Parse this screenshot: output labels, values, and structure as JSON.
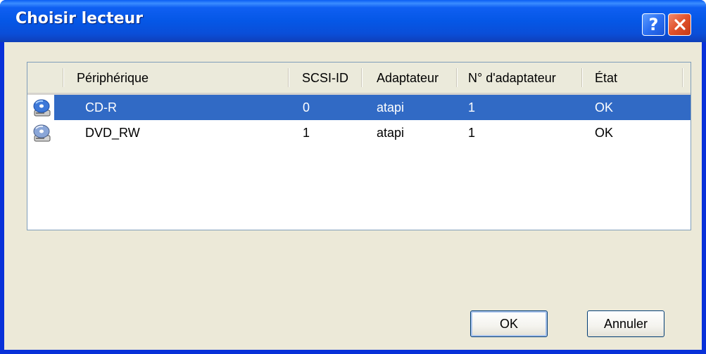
{
  "window": {
    "title": "Choisir lecteur",
    "help_label": "?",
    "close_icon": "close-icon"
  },
  "list": {
    "columns": [
      "Périphérique",
      "SCSI-ID",
      "Adaptateur",
      "N° d'adaptateur",
      "État"
    ],
    "rows": [
      {
        "icon": "optical-drive-icon",
        "device": "CD-R",
        "scsi_id": "0",
        "adapter": "atapi",
        "adapter_no": "1",
        "state": "OK",
        "selected": true
      },
      {
        "icon": "optical-drive-icon",
        "device": "DVD_RW",
        "scsi_id": "1",
        "adapter": "atapi",
        "adapter_no": "1",
        "state": "OK",
        "selected": false
      }
    ]
  },
  "buttons": {
    "ok_label": "OK",
    "cancel_label": "Annuler"
  },
  "colors": {
    "titlebar": "#0557e6",
    "selection": "#316ac5",
    "dialog_bg": "#ece9d8"
  }
}
